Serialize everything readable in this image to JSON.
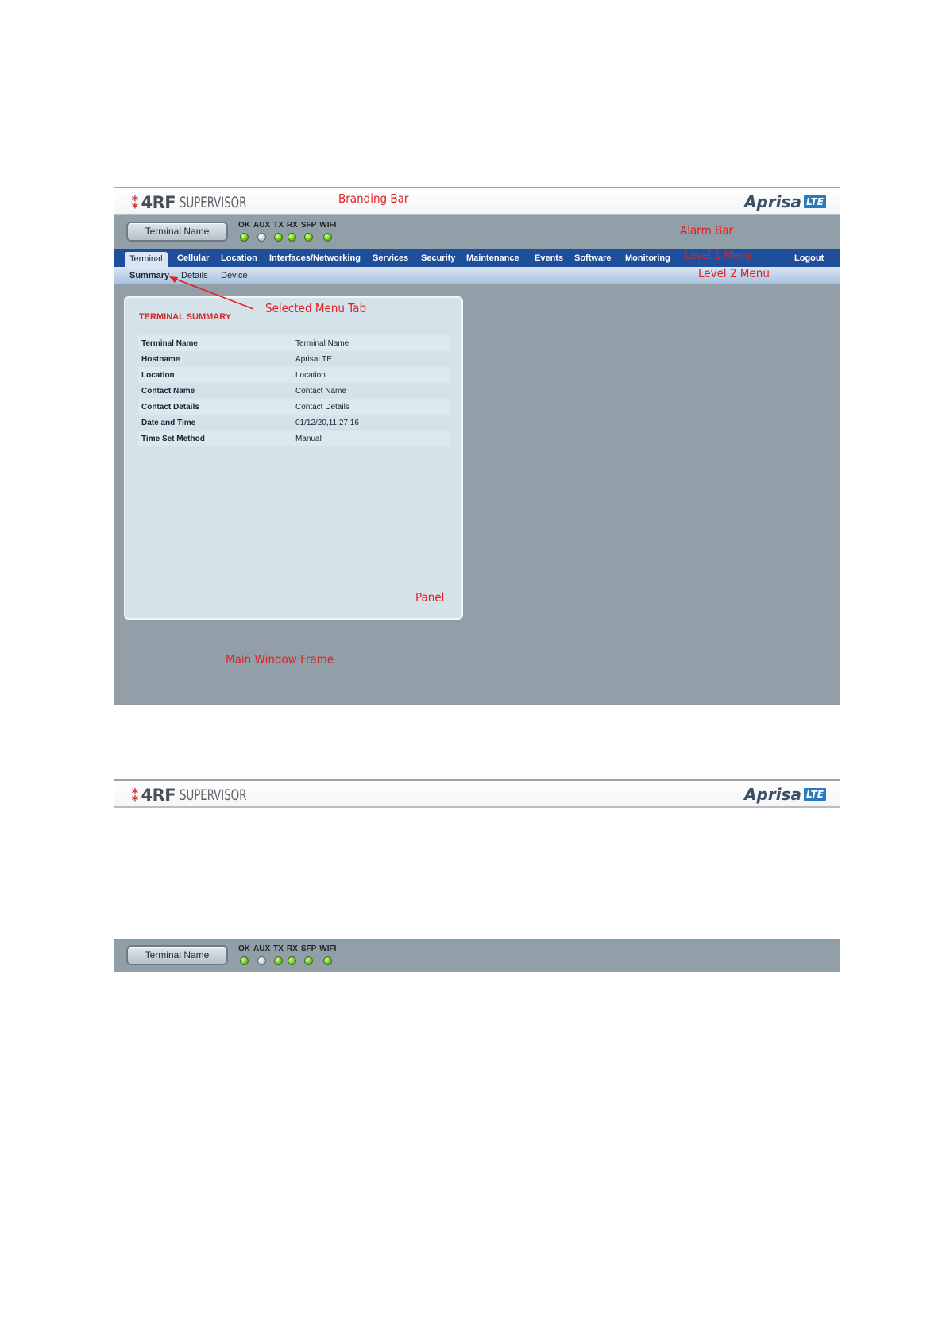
{
  "branding": {
    "logo_mark": "4RF",
    "product": "SUPERVISOR",
    "brand_right": "Aprisa",
    "brand_badge": "LTE"
  },
  "alarm": {
    "terminal_button": "Terminal Name",
    "leds": [
      {
        "label": "OK",
        "state": "green"
      },
      {
        "label": "AUX",
        "state": "grey"
      },
      {
        "label": "TX",
        "state": "green"
      },
      {
        "label": "RX",
        "state": "green"
      },
      {
        "label": "SFP",
        "state": "green"
      },
      {
        "label": "WIFI",
        "state": "green"
      }
    ]
  },
  "nav1": {
    "items": [
      "Terminal",
      "Cellular",
      "Location",
      "Interfaces/Networking",
      "Services",
      "Security",
      "Maintenance",
      "Events",
      "Software",
      "Monitoring"
    ],
    "logout": "Logout"
  },
  "nav2": {
    "items": [
      "Summary",
      "Details",
      "Device"
    ]
  },
  "panel": {
    "title": "TERMINAL SUMMARY",
    "rows": [
      {
        "key": "Terminal Name",
        "value": "Terminal Name"
      },
      {
        "key": "Hostname",
        "value": "AprisaLTE"
      },
      {
        "key": "Location",
        "value": "Location"
      },
      {
        "key": "Contact Name",
        "value": "Contact Name"
      },
      {
        "key": "Contact Details",
        "value": "Contact Details"
      },
      {
        "key": "Date and Time",
        "value": "01/12/20,11:27:16"
      },
      {
        "key": "Time Set Method",
        "value": "Manual"
      }
    ]
  },
  "annotations": {
    "branding_bar": "Branding Bar",
    "alarm_bar": "Alarm Bar",
    "level1_menu": "Level 1 Menu",
    "level2_menu": "Level 2 Menu",
    "selected_menu_tab": "Selected Menu Tab",
    "panel": "Panel",
    "main_window_frame": "Main Window Frame"
  },
  "colors": {
    "annotation": "#e31e1e",
    "nav_blue": "#1f4f9b",
    "frame_grey": "#929fa8",
    "led_green": "#5fc21f"
  }
}
